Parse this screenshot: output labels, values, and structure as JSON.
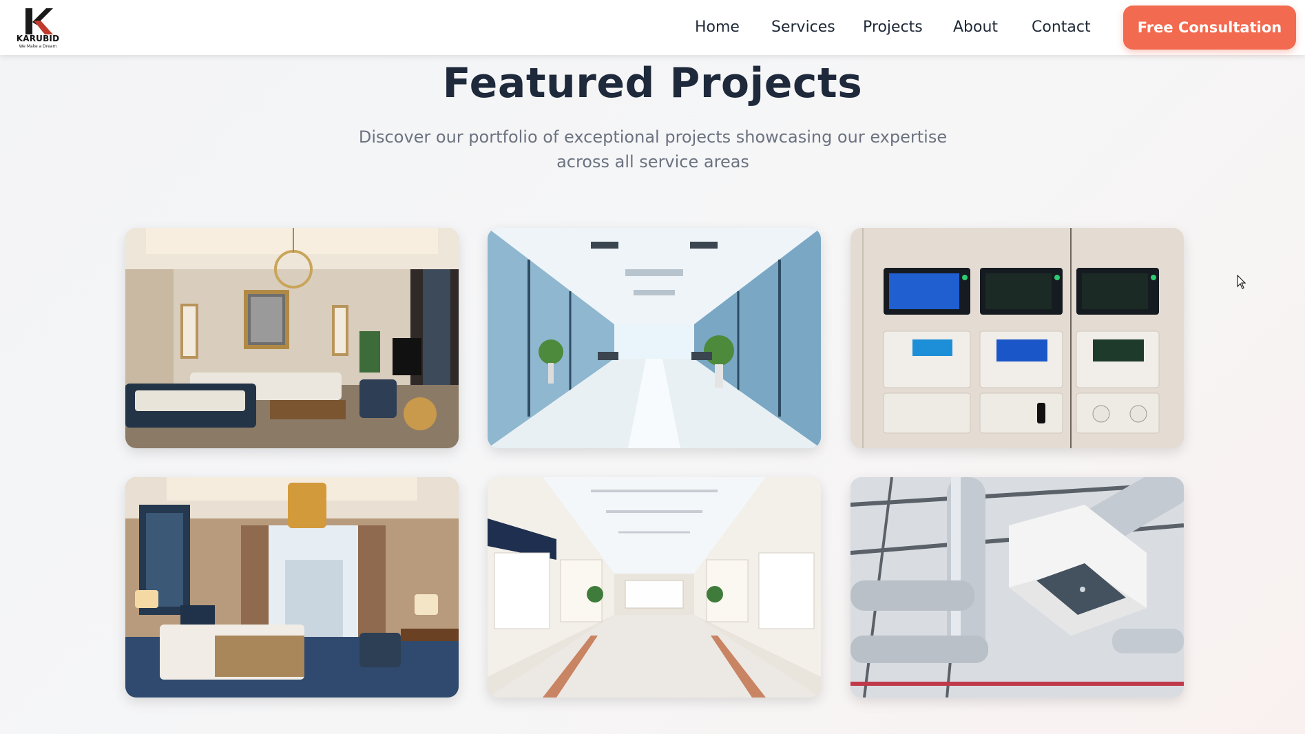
{
  "brand": {
    "name": "KARUBID",
    "tagline": "We Make a Dream"
  },
  "nav": {
    "links": [
      "Home",
      "Services",
      "Projects",
      "About",
      "Contact"
    ],
    "cta_label": "Free Consultation"
  },
  "section": {
    "title": "Featured Projects",
    "subtitle": "Discover our portfolio of exceptional projects showcasing our expertise across all service areas"
  },
  "projects": [
    {
      "image": "luxury-living-room-photo"
    },
    {
      "image": "glass-office-corridor-photo"
    },
    {
      "image": "control-panels-wall-photo"
    },
    {
      "image": "hotel-bedroom-photo"
    },
    {
      "image": "shopping-mall-interior-photo"
    },
    {
      "image": "hvac-ductwork-photo"
    }
  ],
  "colors": {
    "accent": "#f26a4f",
    "heading": "#1e293b",
    "muted": "#6b7280",
    "nav_text": "#1f2937"
  }
}
